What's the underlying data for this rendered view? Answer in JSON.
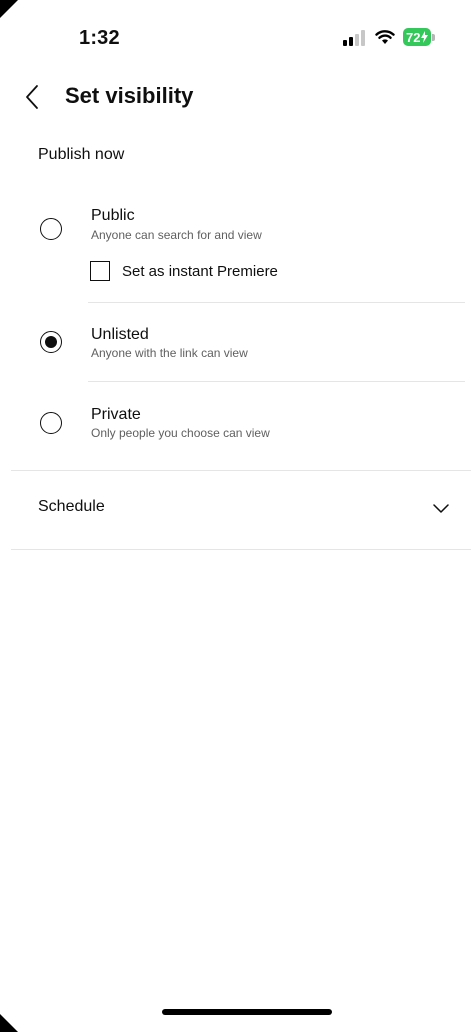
{
  "status_bar": {
    "time": "1:32",
    "battery": "72",
    "battery_color": "#34c759"
  },
  "header": {
    "title": "Set visibility",
    "back_icon": "chevron-left-icon"
  },
  "publish_section": {
    "label": "Publish now",
    "options": [
      {
        "title": "Public",
        "subtitle": "Anyone can search for and view",
        "selected": false
      },
      {
        "title": "Unlisted",
        "subtitle": "Anyone with the link can view",
        "selected": true
      },
      {
        "title": "Private",
        "subtitle": "Only people you choose can view",
        "selected": false
      }
    ],
    "premiere_checkbox": {
      "label": "Set as instant Premiere",
      "checked": false
    }
  },
  "schedule": {
    "label": "Schedule",
    "icon": "chevron-down-icon"
  }
}
